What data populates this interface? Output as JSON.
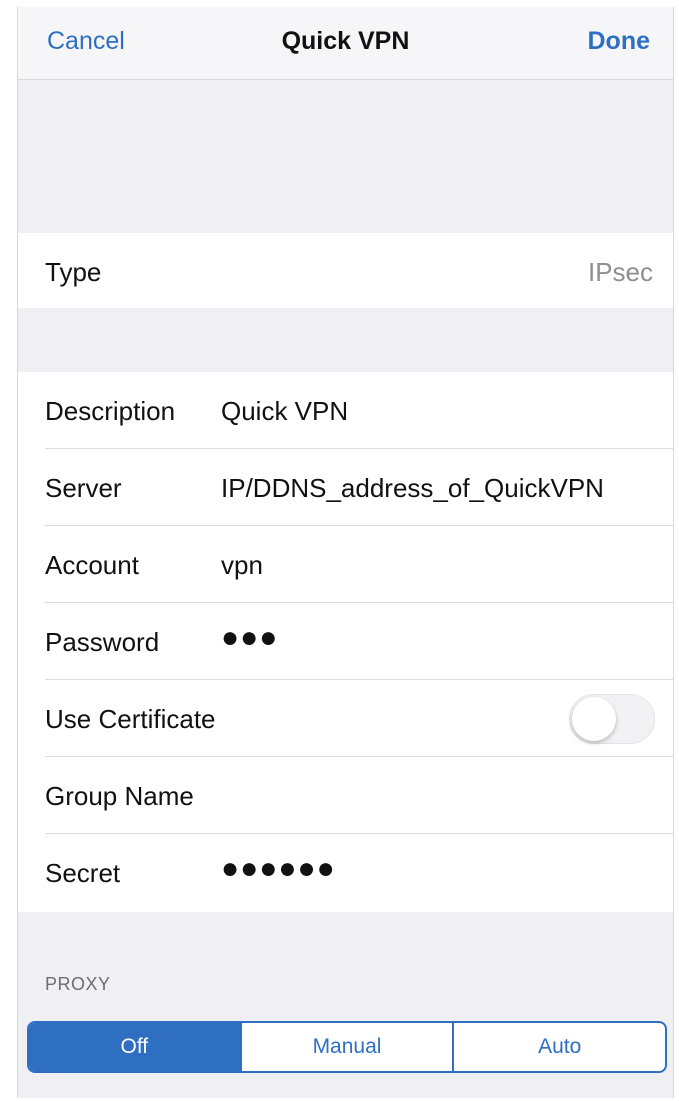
{
  "navbar": {
    "cancel_label": "Cancel",
    "title": "Quick VPN",
    "done_label": "Done"
  },
  "type_row": {
    "label": "Type",
    "value": "IPsec"
  },
  "fields": {
    "description": {
      "label": "Description",
      "value": "Quick VPN"
    },
    "server": {
      "label": "Server",
      "value": "IP/DDNS_address_of_QuickVPN"
    },
    "account": {
      "label": "Account",
      "value": "vpn"
    },
    "password": {
      "label": "Password",
      "value": "●●●"
    },
    "use_certificate": {
      "label": "Use Certificate",
      "enabled": false
    },
    "group_name": {
      "label": "Group Name",
      "value": ""
    },
    "secret": {
      "label": "Secret",
      "value": "●●●●●●"
    }
  },
  "proxy": {
    "header": "PROXY",
    "options": [
      "Off",
      "Manual",
      "Auto"
    ],
    "selected": "Off"
  },
  "colors": {
    "accent": "#2f6fc2",
    "background": "#efeff4",
    "secondary_text": "#8e8e93"
  }
}
